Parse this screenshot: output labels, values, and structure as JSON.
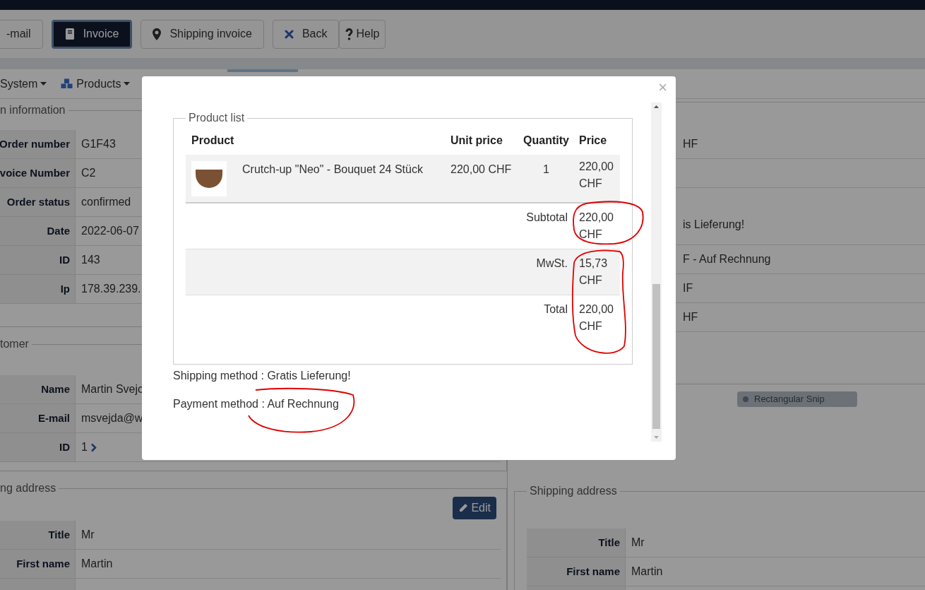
{
  "toolbar": {
    "buttons": [
      {
        "label": "-mail",
        "kind": "plain",
        "selected": false
      },
      {
        "label": "Invoice",
        "kind": "book",
        "selected": true
      },
      {
        "label": "Shipping invoice",
        "kind": "pin",
        "selected": false
      },
      {
        "label": "Back",
        "kind": "cross",
        "selected": false
      },
      {
        "label": "Help",
        "kind": "question",
        "selected": false
      }
    ]
  },
  "nav": [
    {
      "label": "System",
      "kind": "plain"
    },
    {
      "label": "Products",
      "kind": "cubes"
    }
  ],
  "order_information": {
    "legend": "n information",
    "rows": [
      {
        "label": "Order number",
        "value": "G1F43"
      },
      {
        "label": "voice Number",
        "value": "C2"
      },
      {
        "label": "Order status",
        "value": "confirmed"
      },
      {
        "label": "Date",
        "value": "2022-06-07"
      },
      {
        "label": "ID",
        "value": "143"
      },
      {
        "label": "Ip",
        "value": "178.39.239."
      }
    ]
  },
  "customer": {
    "legend": "tomer",
    "rows": [
      {
        "label": "Name",
        "value": "Martin Svejc",
        "kind": "text"
      },
      {
        "label": "E-mail",
        "value": "msvejda@w",
        "kind": "text"
      },
      {
        "label": "ID",
        "value": "1",
        "kind": "link"
      }
    ]
  },
  "right_panel_rows": [
    {
      "text": "HF"
    },
    {
      "text": "is Lieferung!"
    },
    {
      "text": "F - Auf Rechnung"
    },
    {
      "text": "IF"
    },
    {
      "text": "HF"
    }
  ],
  "snip_hint": "Rectangular Snip",
  "billing_address": {
    "legend": "ng address",
    "edit_button": "Edit",
    "rows": [
      {
        "label": "Title",
        "value": "Mr"
      },
      {
        "label": "First name",
        "value": "Martin"
      }
    ]
  },
  "shipping_address": {
    "legend": "Shipping address",
    "rows": [
      {
        "label": "Title",
        "value": "Mr"
      },
      {
        "label": "First name",
        "value": "Martin"
      }
    ]
  },
  "modal": {
    "close": "×",
    "product_list": {
      "legend": "Product list",
      "columns": [
        "Product",
        "Unit price",
        "Quantity",
        "Price"
      ],
      "rows": [
        {
          "name": "Crutch-up \"Neo\" - Bouquet 24 Stück",
          "unit_price": "220,00 CHF",
          "quantity": "1",
          "price": "220,00 CHF"
        }
      ],
      "totals": [
        {
          "label": "Subtotal",
          "value": "220,00 CHF"
        },
        {
          "label": "MwSt.",
          "value": "15,73 CHF"
        },
        {
          "label": "Total",
          "value": "220,00 CHF"
        }
      ]
    },
    "shipping_method": "Shipping method : Gratis Lieferung!",
    "payment_method": "Payment method : Auf Rechnung"
  }
}
